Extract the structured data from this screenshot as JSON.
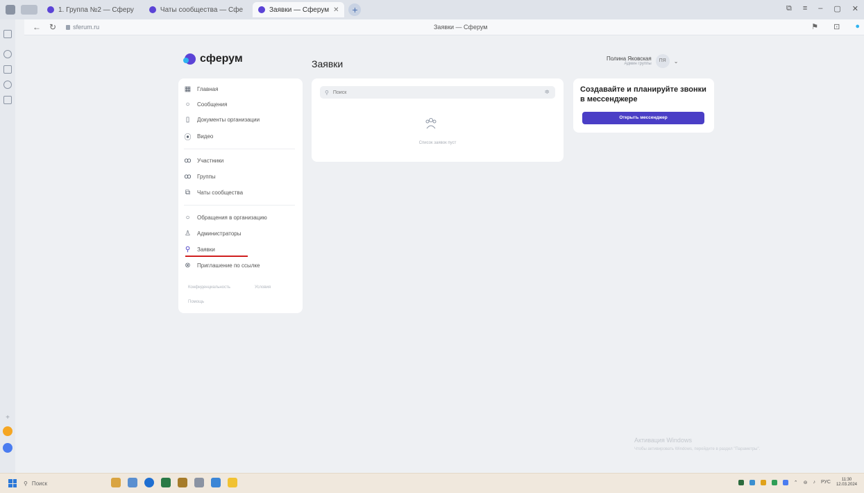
{
  "browser": {
    "tabs": [
      {
        "label": "1. Группа №2 — Сферу"
      },
      {
        "label": "Чаты сообщества — Сфе"
      },
      {
        "label": "Заявки — Сферум",
        "active": true
      }
    ],
    "url": "sferum.ru",
    "page_title": "Заявки — Сферум"
  },
  "header": {
    "logo_text": "сферум",
    "page_heading": "Заявки",
    "user_name": "Полина Яковская",
    "user_role": "Админ группы",
    "avatar_initials": "ПЯ"
  },
  "nav": {
    "group1": [
      {
        "label": "Главная",
        "icon": "home-icon"
      },
      {
        "label": "Сообщения",
        "icon": "chat-icon"
      },
      {
        "label": "Документы организации",
        "icon": "document-icon"
      },
      {
        "label": "Видео",
        "icon": "video-icon"
      }
    ],
    "group2": [
      {
        "label": "Участники",
        "icon": "members-icon"
      },
      {
        "label": "Группы",
        "icon": "groups-icon"
      },
      {
        "label": "Чаты сообщества",
        "icon": "community-chats-icon"
      }
    ],
    "group3": [
      {
        "label": "Обращения в организацию",
        "icon": "appeal-icon"
      },
      {
        "label": "Администраторы",
        "icon": "admin-icon"
      },
      {
        "label": "Заявки",
        "icon": "add-user-icon",
        "active": true
      },
      {
        "label": "Приглашение по ссылке",
        "icon": "invite-link-icon"
      }
    ],
    "footer": {
      "privacy": "Конфиденциальность",
      "terms": "Условия",
      "help": "Помощь"
    }
  },
  "requests": {
    "search_placeholder": "Поиск",
    "empty_text": "Список заявок пуст"
  },
  "promo": {
    "title": "Создавайте и планируйте звонки в мессенджере",
    "button": "Открыть мессенджер"
  },
  "watermark": {
    "line1": "Активация Windows",
    "line2": "Чтобы активировать Windows, перейдите в раздел \"Параметры\"."
  },
  "taskbar": {
    "search": "Поиск",
    "clock_time": "11:30",
    "clock_date": "12.03.2024",
    "lang": "РУС"
  },
  "colors": {
    "accent": "#4a3ec6",
    "brand": "#5b43d6",
    "active_underline": "#d01e1e"
  }
}
